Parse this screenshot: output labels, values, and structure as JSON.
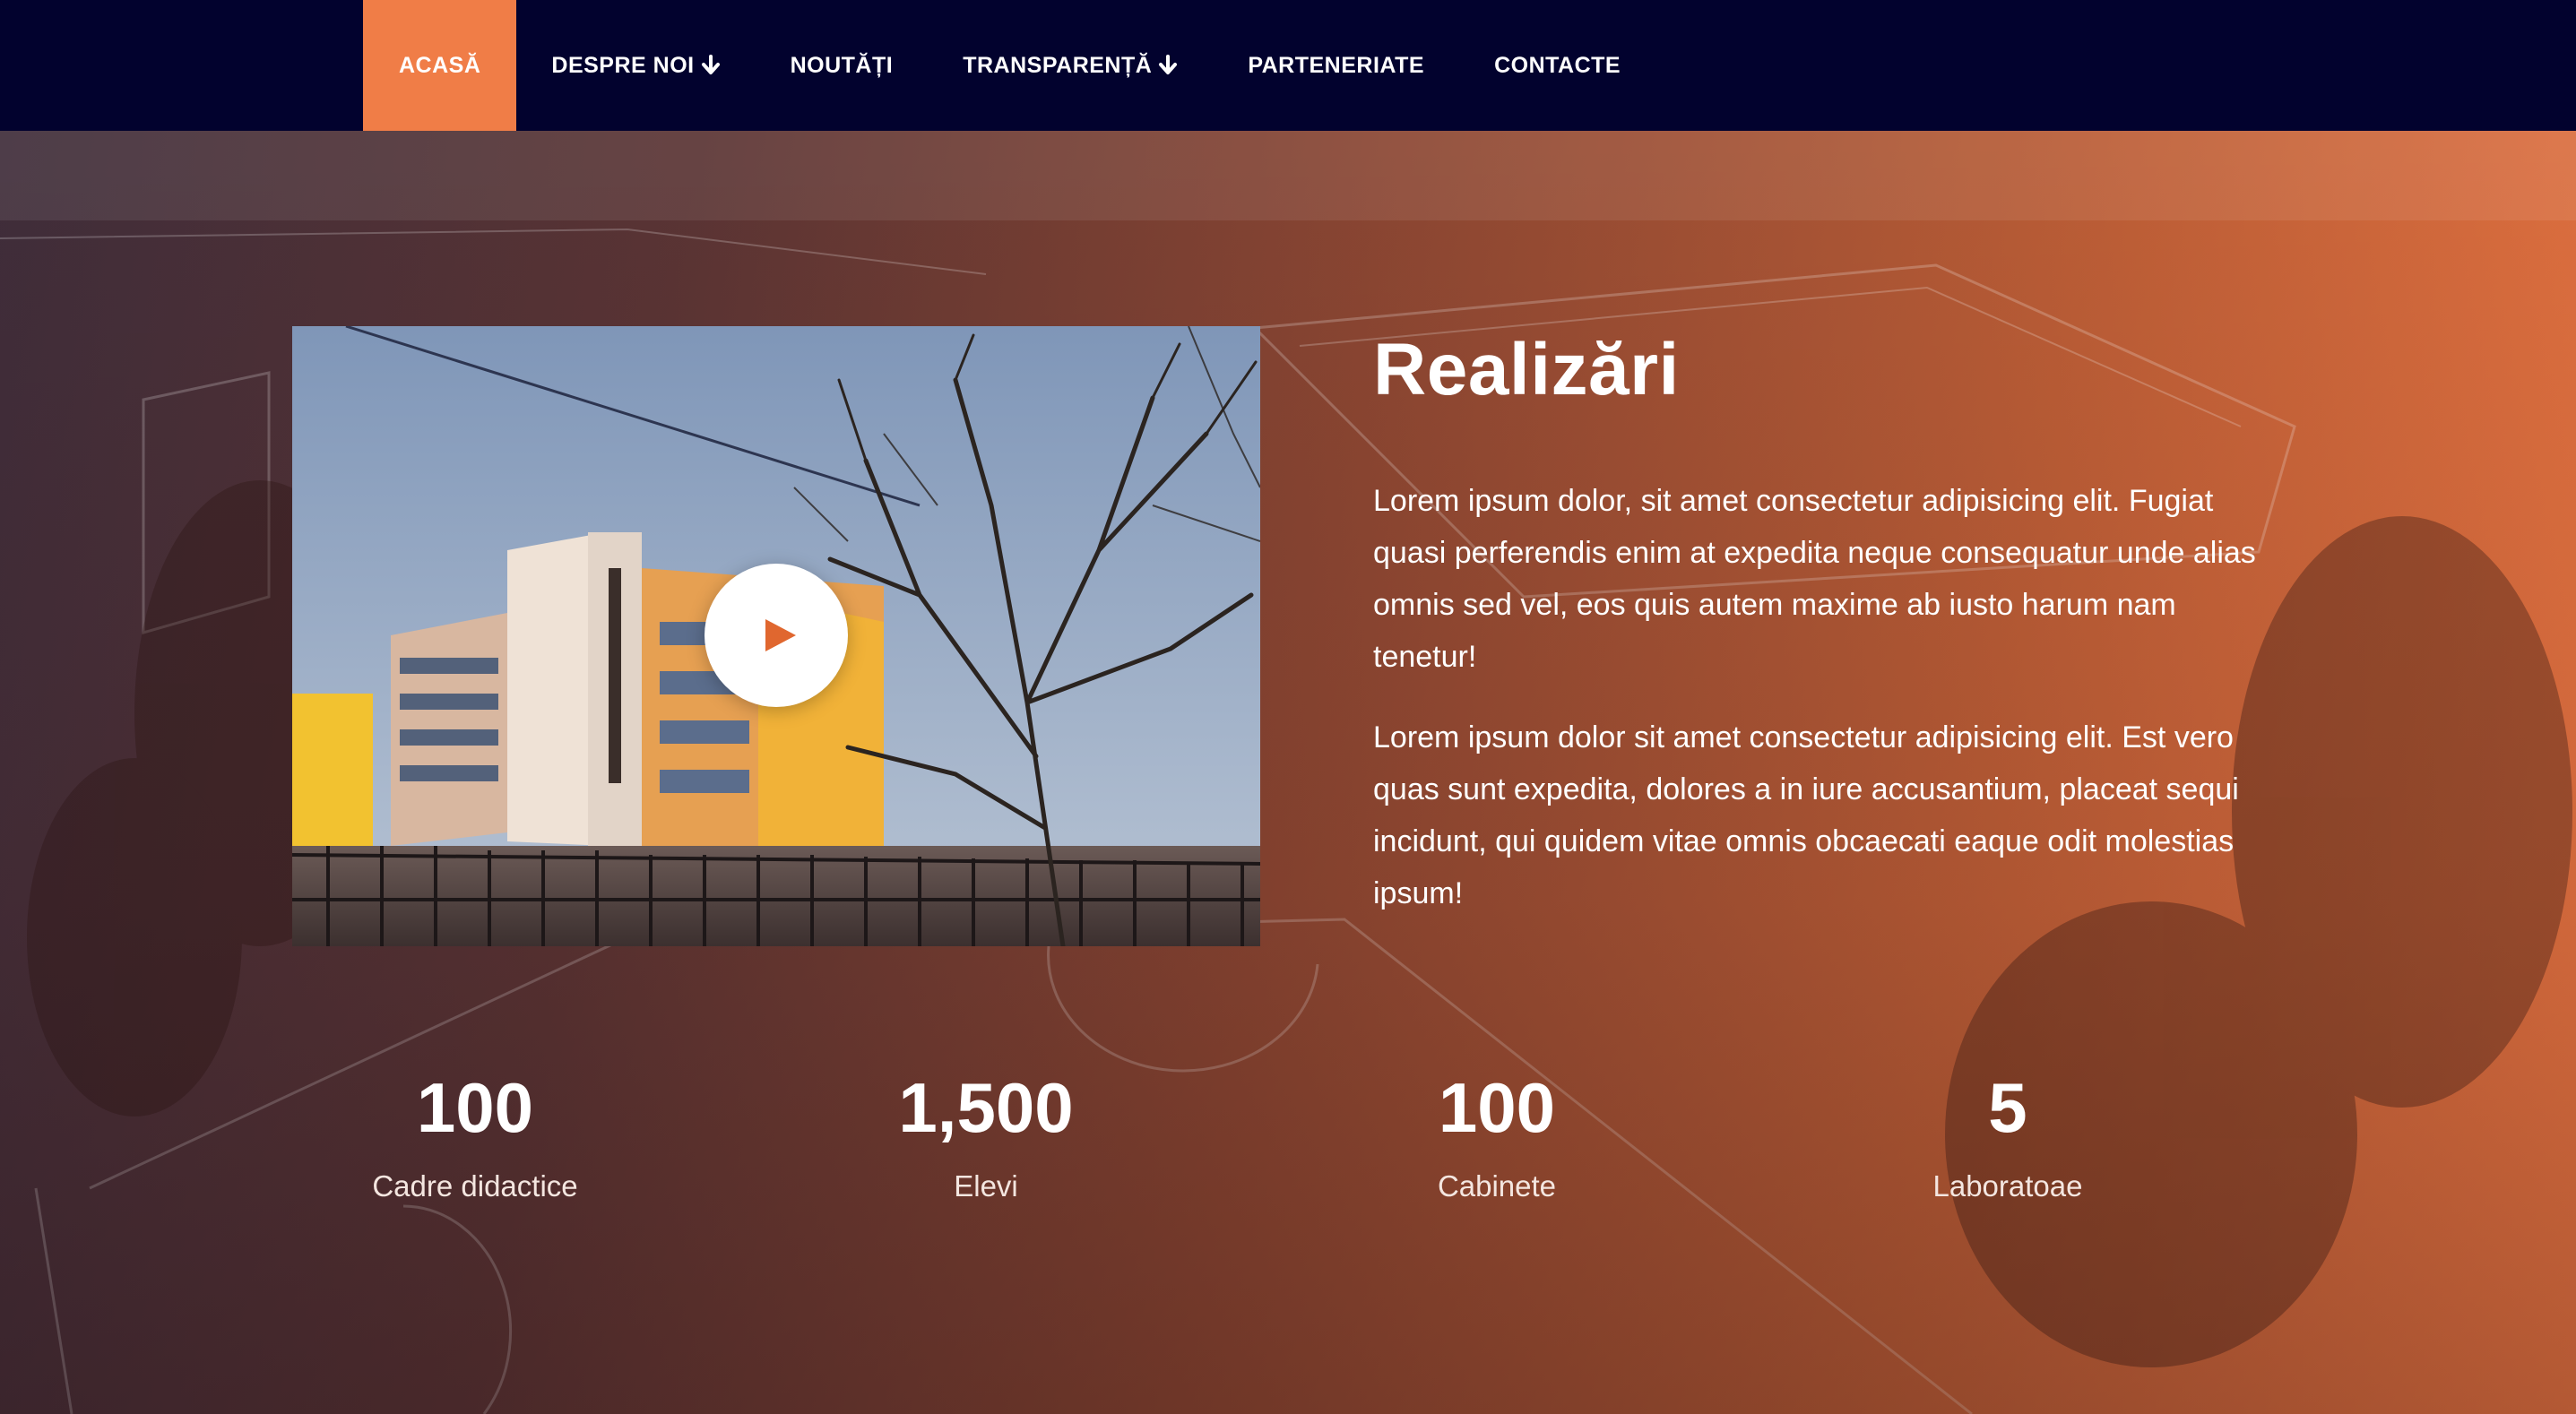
{
  "nav": {
    "items": [
      {
        "label": "ACASĂ",
        "active": true,
        "dropdown": false
      },
      {
        "label": "DESPRE NOI",
        "active": false,
        "dropdown": true
      },
      {
        "label": "NOUTĂȚI",
        "active": false,
        "dropdown": false
      },
      {
        "label": "TRANSPARENȚĂ",
        "active": false,
        "dropdown": true
      },
      {
        "label": "PARTENERIATE",
        "active": false,
        "dropdown": false
      },
      {
        "label": "CONTACTE",
        "active": false,
        "dropdown": false
      }
    ],
    "active_color": "#f07d47",
    "background_color": "#02022e"
  },
  "achievements": {
    "title": "Realizări",
    "paragraph1": "Lorem ipsum dolor, sit amet consectetur adipisicing elit. Fugiat quasi perferendis enim at expedita neque consequatur unde alias omnis sed vel, eos quis autem maxime ab iusto harum nam tenetur!",
    "paragraph2": "Lorem ipsum dolor sit amet consectetur adipisicing elit. Est vero quas sunt expedita, dolores a in iure accusantium, placeat sequi incidunt, qui quidem vitae omnis obcaecati eaque odit molestias ipsum!",
    "video": {
      "play_icon": "play-icon"
    }
  },
  "stats": [
    {
      "number": "100",
      "label": "Cadre didactice"
    },
    {
      "number": "1,500",
      "label": "Elevi"
    },
    {
      "number": "100",
      "label": "Cabinete"
    },
    {
      "number": "5",
      "label": "Laboratoae"
    }
  ],
  "colors": {
    "accent": "#f07d47",
    "play_arrow": "#e0672f"
  }
}
